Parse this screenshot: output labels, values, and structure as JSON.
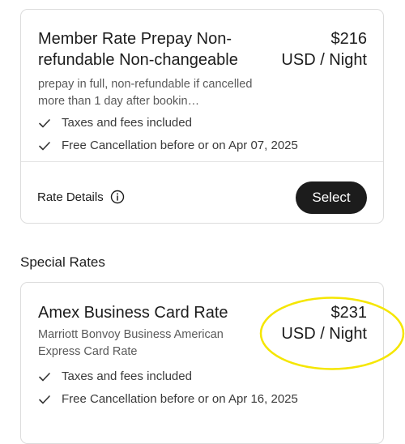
{
  "rates": [
    {
      "title": "Member Rate Prepay Non-refundable Non-changeable",
      "price": "$216",
      "price_unit": "USD / Night",
      "description": "prepay in full,  non-refundable if cancelled more than 1 day after bookin…",
      "features": [
        "Taxes and fees included",
        "Free Cancellation before or on Apr 07, 2025"
      ],
      "details_label": "Rate Details",
      "select_label": "Select"
    }
  ],
  "special_rates": {
    "heading": "Special Rates",
    "items": [
      {
        "title": "Amex Business Card Rate",
        "price": "$231",
        "price_unit": "USD / Night",
        "description": "Marriott Bonvoy Business American Express Card Rate",
        "features": [
          "Taxes and fees included",
          "Free Cancellation before or on Apr 16, 2025"
        ]
      }
    ]
  },
  "icons": {
    "check": "check-icon",
    "info": "info-icon"
  },
  "colors": {
    "button_bg": "#1c1c1c",
    "highlight": "#f5e600"
  }
}
